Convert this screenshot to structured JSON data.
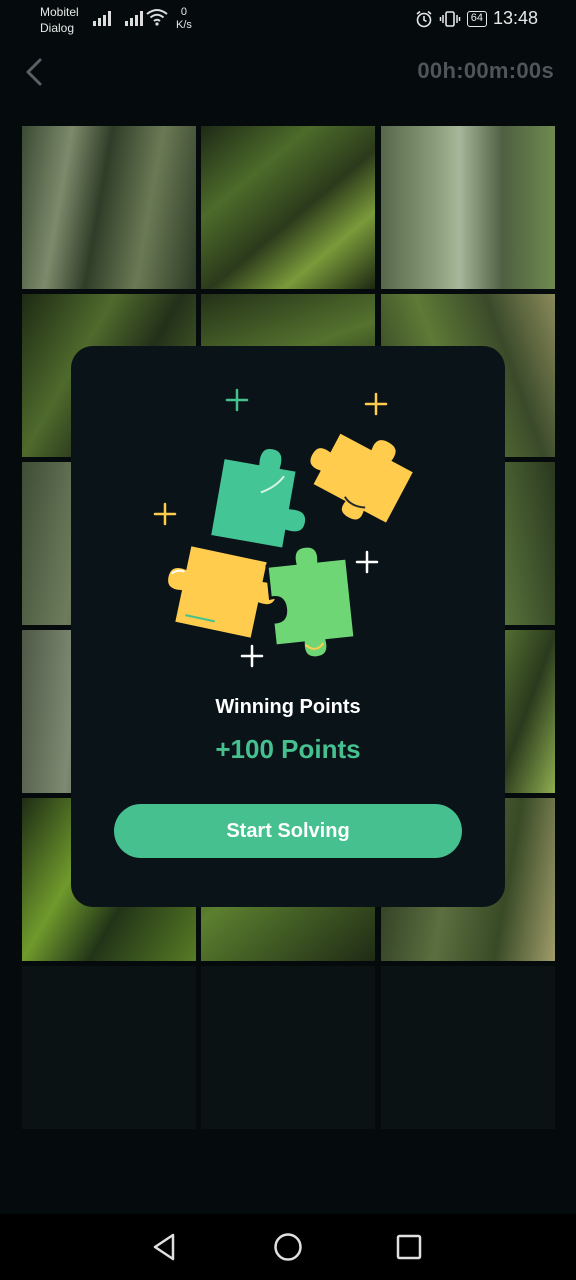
{
  "status_bar": {
    "carrier_1": "Mobitel",
    "carrier_2": "Dialog",
    "speed_value": "0",
    "speed_unit": "K/s",
    "battery": "64",
    "time": "13:48"
  },
  "header": {
    "timer": "00h:00m:00s"
  },
  "modal": {
    "title": "Winning Points",
    "points": "+100 Points",
    "button_label": "Start Solving"
  },
  "colors": {
    "accent": "#46c08f",
    "modal_bg": "#0a1418",
    "piece_yellow": "#ffcc4d",
    "piece_teal": "#43c596",
    "piece_green": "#6fd676"
  },
  "icons": {
    "back": "chevron-left-icon",
    "nav_back": "triangle-back-icon",
    "nav_home": "circle-home-icon",
    "nav_recent": "square-recent-icon"
  }
}
